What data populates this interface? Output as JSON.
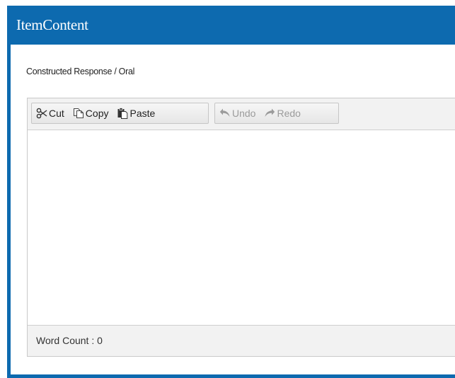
{
  "window": {
    "title": "ItemContent"
  },
  "item": {
    "subtitle": "Constructed Response / Oral"
  },
  "toolbar": {
    "cut_label": "Cut",
    "copy_label": "Copy",
    "paste_label": "Paste",
    "undo_label": "Undo",
    "redo_label": "Redo",
    "icons": [
      "scissors-icon",
      "copy-icon",
      "paste-icon",
      "undo-icon",
      "redo-icon"
    ]
  },
  "editor": {
    "content": ""
  },
  "status": {
    "word_count": "Word Count : 0"
  },
  "colors": {
    "title_bar": "#0d6aaf",
    "toolbar_bg": "#f2f2f2",
    "disabled_text": "#9b9b9b"
  }
}
